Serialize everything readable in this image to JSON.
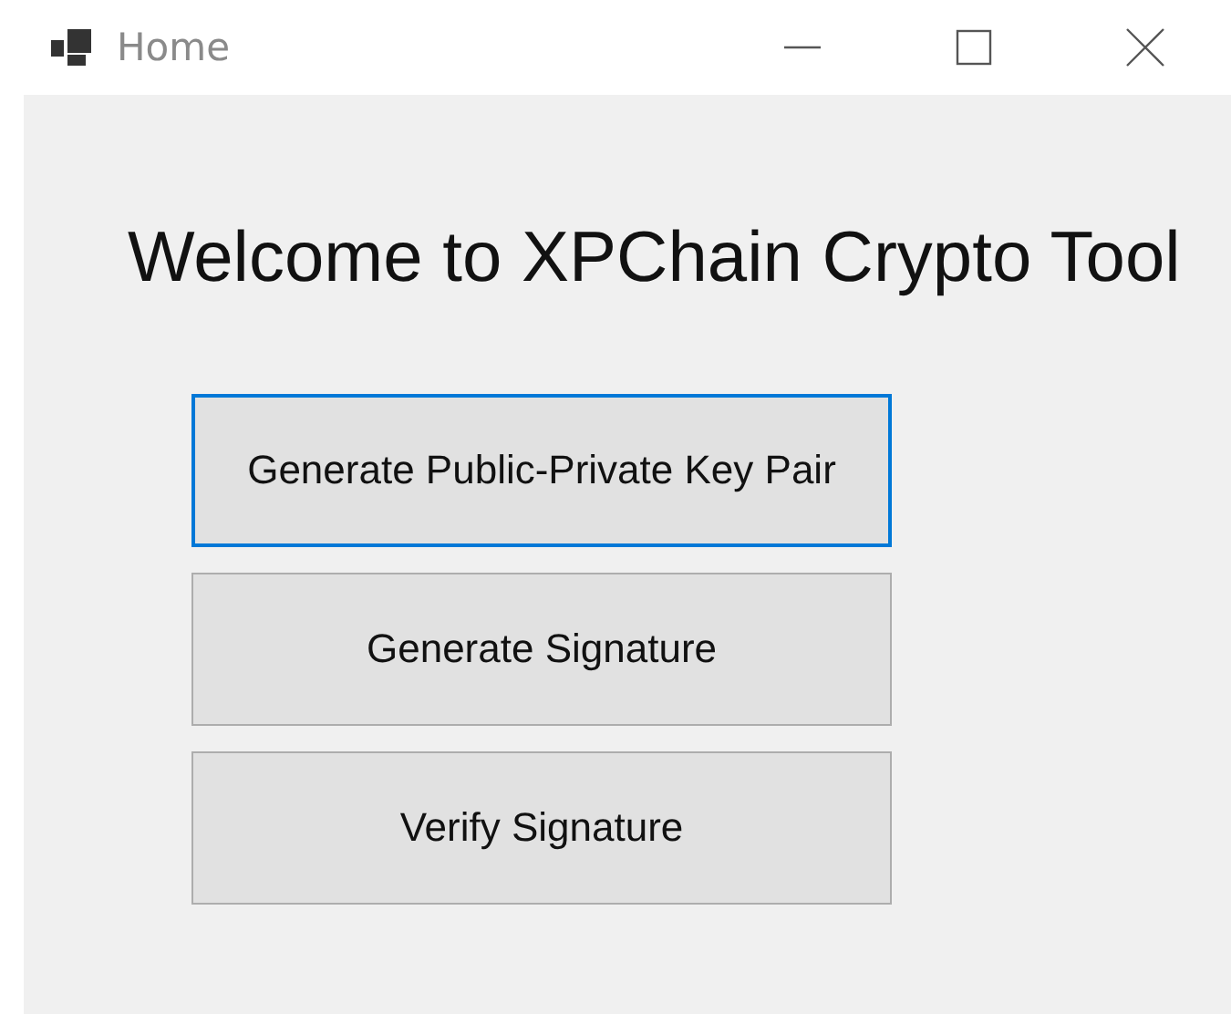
{
  "window": {
    "title": "Home"
  },
  "heading": "Welcome to XPChain Crypto Tool",
  "buttons": [
    {
      "label": "Generate Public-Private Key Pair",
      "focused": true
    },
    {
      "label": "Generate Signature",
      "focused": false
    },
    {
      "label": "Verify Signature",
      "focused": false
    }
  ]
}
